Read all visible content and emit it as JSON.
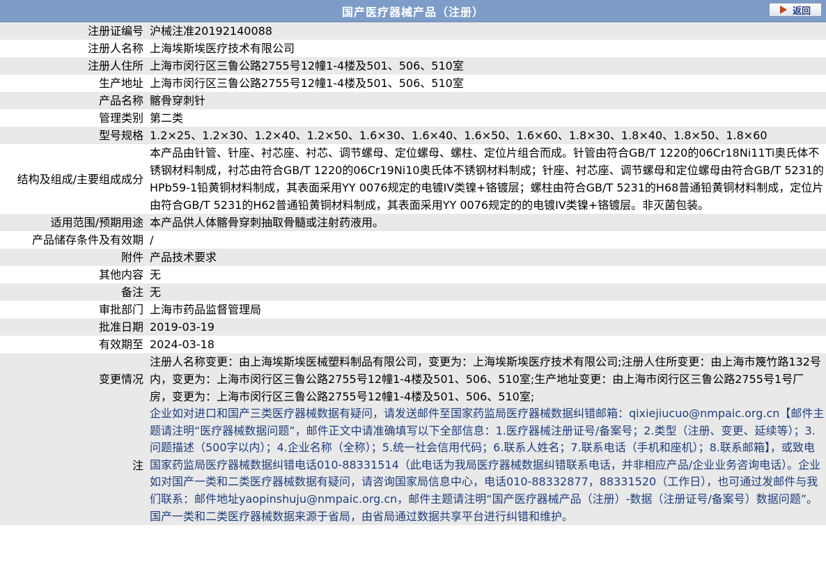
{
  "header": {
    "title": "国产医疗器械产品（注册）",
    "back_label": "返回"
  },
  "rows": [
    {
      "label": "注册证编号",
      "value": "沪械注准20192140088"
    },
    {
      "label": "注册人名称",
      "value": "上海埃斯埃医疗技术有限公司"
    },
    {
      "label": "注册人住所",
      "value": "上海市闵行区三鲁公路2755号12幢1-4楼及501、506、510室"
    },
    {
      "label": "生产地址",
      "value": "上海市闵行区三鲁公路2755号12幢1-4楼及501、506、510室"
    },
    {
      "label": "产品名称",
      "value": "髂骨穿刺针"
    },
    {
      "label": "管理类别",
      "value": "第二类"
    },
    {
      "label": "型号规格",
      "value": "1.2×25、1.2×30、1.2×40、1.2×50、1.6×30、1.6×40、1.6×50、1.6×60、1.8×30、1.8×40、1.8×50、1.8×60"
    },
    {
      "label": "结构及组成/主要组成成分",
      "value": "本产品由针管、针座、衬芯座、衬芯、调节螺母、定位螺母、螺柱、定位片组合而成。针管由符合GB/T 1220的06Cr18Ni11Ti奥氏体不锈钢材料制成，衬芯由符合GB/T 1220的06Cr19Ni10奥氏体不锈钢材料制成；针座、衬芯座、调节螺母和定位螺母由符合GB/T 5231的HPb59-1铅黄铜材料制成，其表面采用YY 0076规定的电镀IV类镍+铬镀层；螺柱由符合GB/T 5231的H68普通铅黄铜材料制成，定位片由符合GB/T 5231的H62普通铅黄铜材料制成，其表面采用YY 0076规定的的电镀IV类镍+铬镀层。非灭菌包装。"
    },
    {
      "label": "适用范围/预期用途",
      "value": "本产品供人体髂骨穿刺抽取骨髓或注射药液用。"
    },
    {
      "label": "产品储存条件及有效期",
      "value": "/"
    },
    {
      "label": "附件",
      "value": "产品技术要求"
    },
    {
      "label": "其他内容",
      "value": "无"
    },
    {
      "label": "备注",
      "value": "无"
    },
    {
      "label": "审批部门",
      "value": "上海市药品监督管理局"
    },
    {
      "label": "批准日期",
      "value": "2019-03-19"
    },
    {
      "label": "有效期至",
      "value": "2024-03-18"
    },
    {
      "label": "变更情况",
      "value": "注册人名称变更：由上海埃斯埃医械塑料制品有限公司，变更为：上海埃斯埃医疗技术有限公司;注册人住所变更：由上海市篾竹路132号内，变更为：上海市闵行区三鲁公路2755号12幢1-4楼及501、506、510室;生产地址变更：由上海市闵行区三鲁公路2755号1号厂房，变更为：上海市闵行区三鲁公路2755号12幢1-4楼及501、506、510室;"
    },
    {
      "label": "注",
      "value": "企业如对进口和国产三类医疗器械数据有疑问，请发送邮件至国家药监局医疗器械数据纠错邮箱：qixiejiucuo@nmpaic.org.cn【邮件主题请注明“医疗器械数据问题”，邮件正文中请准确填写以下全部信息：1.医疗器械注册证号/备案号；2.类型（注册、变更、延续等）；3.问题描述（500字以内）；4.企业名称（全称）；5.统一社会信用代码；6.联系人姓名；7.联系电话（手机和座机）；8.联系邮箱】，或致电国家药监局医疗器械数据纠错电话010-88331514（此电话为我局医疗器械数据纠错联系电话，并非相应产品/企业业务咨询电话）。企业如对国产一类和二类医疗器械数据有疑问，请咨询国家局信息中心，电话010-88332877，88331520（工作日），也可通过发邮件与我们联系：邮件地址yaopinshuju@nmpaic.org.cn，邮件主题请注明“国产医疗器械产品（注册）-数据（注册证号/备案号）数据问题”。国产一类和二类医疗器械数据来源于省局，由省局通过数据共享平台进行纠错和维护。"
    }
  ]
}
